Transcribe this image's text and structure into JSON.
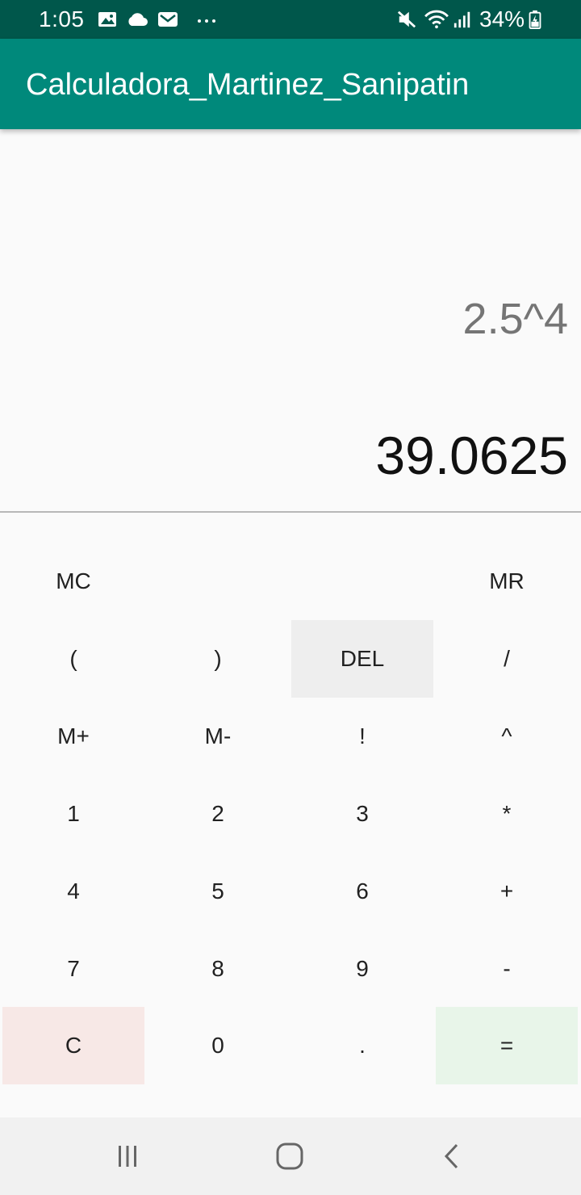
{
  "status_bar": {
    "time": "1:05",
    "battery": "34%",
    "icons": [
      "gallery-icon",
      "cloud-icon",
      "mail-icon",
      "more-notifications-icon",
      "mute-icon",
      "wifi-icon",
      "signal-icon",
      "battery-icon"
    ]
  },
  "app_bar": {
    "title": "Calculadora_Martinez_Sanipatin",
    "color": "#00897b"
  },
  "display": {
    "expression": "2.5^4",
    "result": "39.0625"
  },
  "keypad": {
    "mc": "MC",
    "mr": "MR",
    "open_paren": "(",
    "close_paren": ")",
    "del": "DEL",
    "divide": "/",
    "m_plus": "M+",
    "m_minus": "M-",
    "factorial": "!",
    "power": "^",
    "one": "1",
    "two": "2",
    "three": "3",
    "multiply": "*",
    "four": "4",
    "five": "5",
    "six": "6",
    "plus": "+",
    "seven": "7",
    "eight": "8",
    "nine": "9",
    "minus": "-",
    "clear": "C",
    "zero": "0",
    "decimal": ".",
    "equals": "="
  },
  "nav_bar": {
    "icons": [
      "recent-apps-icon",
      "home-icon",
      "back-icon"
    ]
  }
}
